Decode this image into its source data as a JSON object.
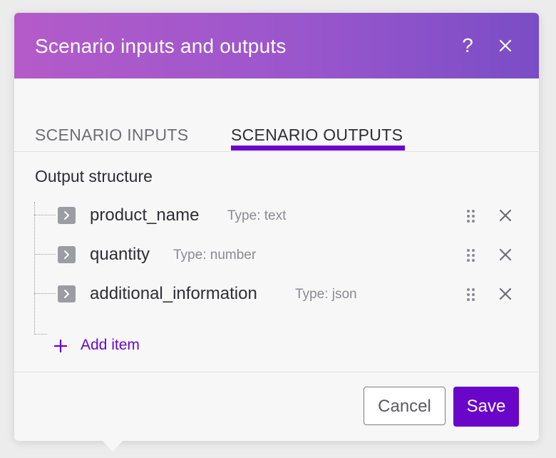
{
  "dialog": {
    "title": "Scenario inputs and outputs",
    "help_label": "?",
    "close_icon": "close-icon"
  },
  "tabs": [
    {
      "label": "SCENARIO INPUTS",
      "active": false
    },
    {
      "label": "SCENARIO OUTPUTS",
      "active": true
    }
  ],
  "output": {
    "section_label": "Output structure",
    "items": [
      {
        "name": "product_name",
        "type": "Type: text"
      },
      {
        "name": "quantity",
        "type": "Type: number"
      },
      {
        "name": "additional_information",
        "type": "Type: json"
      }
    ],
    "add_item_label": "Add item"
  },
  "footer": {
    "cancel_label": "Cancel",
    "save_label": "Save"
  },
  "colors": {
    "accent": "#6a06c9",
    "header_gradient_start": "#b45bc9",
    "header_gradient_end": "#7a4dc6"
  }
}
